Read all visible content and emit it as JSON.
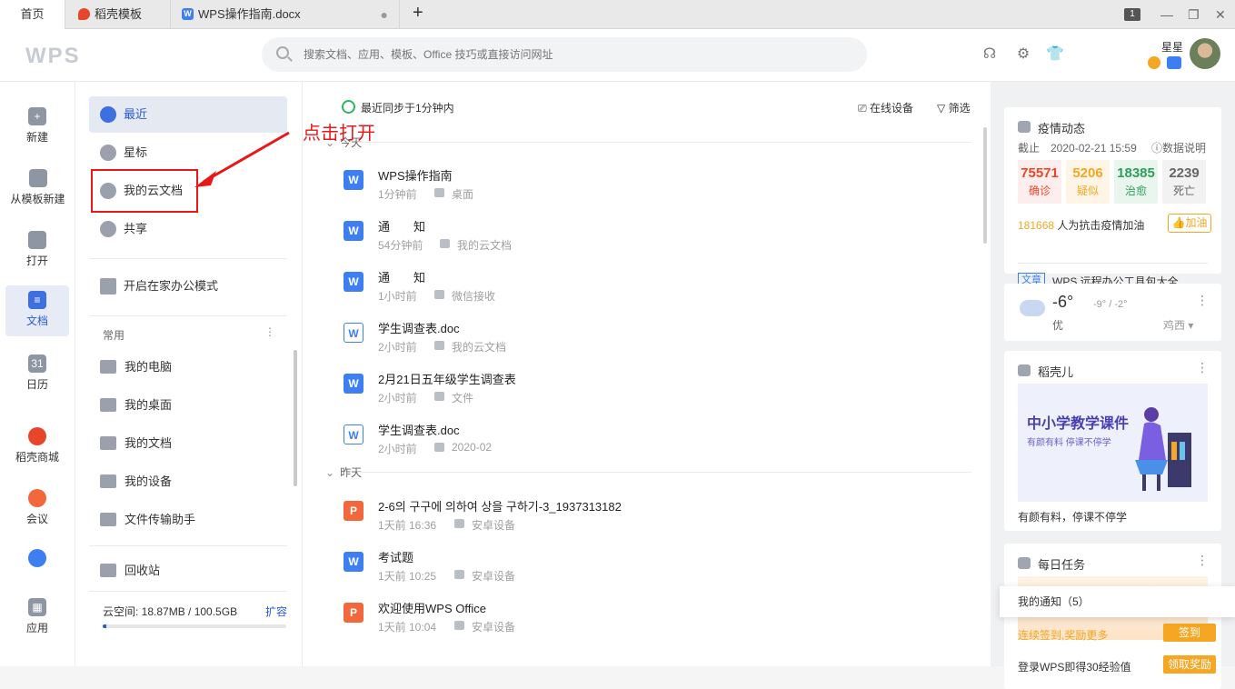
{
  "tabs": {
    "home": "首页",
    "templates": "稻壳模板",
    "document": "WPS操作指南.docx",
    "window_count": "1"
  },
  "search": {
    "placeholder": "搜索文档、应用、模板、Office 技巧或直接访问网址"
  },
  "user": {
    "name": "星星"
  },
  "rail": [
    {
      "label": "新建",
      "icon": "plus-circle-icon"
    },
    {
      "label": "从模板新建",
      "icon": "template-icon"
    },
    {
      "label": "打开",
      "icon": "folder-icon"
    },
    {
      "label": "文档",
      "icon": "document-icon"
    },
    {
      "label": "日历",
      "icon": "calendar-icon"
    },
    {
      "label": "稻壳商城",
      "icon": "docer-store-icon"
    },
    {
      "label": "会议",
      "icon": "meeting-icon"
    },
    {
      "label": "应用",
      "icon": "apps-icon"
    }
  ],
  "nav": {
    "items": [
      {
        "label": "最近",
        "icon": "clock-icon"
      },
      {
        "label": "星标",
        "icon": "star-icon"
      },
      {
        "label": "我的云文档",
        "icon": "cloud-box-icon"
      },
      {
        "label": "共享",
        "icon": "people-icon"
      }
    ],
    "home_mode": "开启在家办公模式",
    "common_label": "常用",
    "common": [
      {
        "label": "我的电脑",
        "icon": "computer-shortcut-icon"
      },
      {
        "label": "我的桌面",
        "icon": "desktop-shortcut-icon"
      },
      {
        "label": "我的文档",
        "icon": "documents-shortcut-icon"
      },
      {
        "label": "我的设备",
        "icon": "devices-icon"
      },
      {
        "label": "文件传输助手",
        "icon": "transfer-icon"
      }
    ],
    "trash": "回收站",
    "cloud_space": "云空间: 18.87MB / 100.5GB",
    "expand": "扩容",
    "usage_fraction": 0.02
  },
  "annotation": "点击打开",
  "main": {
    "sync": "最近同步于1分钟内",
    "online_devices": "在线设备",
    "filter": "筛选",
    "group_today": "今天",
    "group_yesterday": "昨天",
    "files": [
      {
        "name": "WPS操作指南",
        "time": "1分钟前",
        "location": "桌面",
        "type": "w"
      },
      {
        "name": "通　　知",
        "time": "54分钟前",
        "location": "我的云文档",
        "type": "w"
      },
      {
        "name": "通　　知",
        "time": "1小时前",
        "location": "微信接收",
        "type": "w"
      },
      {
        "name": "学生调查表.doc",
        "time": "2小时前",
        "location": "我的云文档",
        "type": "wo"
      },
      {
        "name": "2月21日五年级学生调查表",
        "time": "2小时前",
        "location": "文件",
        "type": "w"
      },
      {
        "name": "学生调查表.doc",
        "time": "2小时前",
        "location": "2020-02",
        "type": "wo"
      },
      {
        "name": "2-6의 구구에 의하여 상을 구하기-3_1937313182",
        "time": "1天前 16:36",
        "location": "安卓设备",
        "type": "p"
      },
      {
        "name": "考试题",
        "time": "1天前 10:25",
        "location": "安卓设备",
        "type": "w"
      },
      {
        "name": "欢迎使用WPS Office",
        "time": "1天前 10:04",
        "location": "安卓设备",
        "type": "p"
      }
    ]
  },
  "covid": {
    "title": "疫情动态",
    "date": "截止　2020-02-21 15:59",
    "help": "数据说明",
    "stats": [
      {
        "value": "75571",
        "label": "确诊",
        "color": "#e8462b"
      },
      {
        "value": "5206",
        "label": "疑似",
        "color": "#f5a623"
      },
      {
        "value": "18385",
        "label": "治愈",
        "color": "#2e9e5b"
      },
      {
        "value": "2239",
        "label": "死亡",
        "color": "#666666"
      }
    ],
    "support_count": "181668",
    "support_text": "人为抗击疫情加油",
    "cheer": "加油",
    "news_tag": "文章",
    "news": "WPS 远程办公工具包大全"
  },
  "weather": {
    "temp": "-6°",
    "range": "-9° / -2°",
    "aq": "优",
    "city": "鸡西 ▾"
  },
  "docer": {
    "title": "稻壳儿",
    "banner_title": "中小学教学课件",
    "banner_sub": "有颜有料  停课不停学",
    "caption": "有颜有料，停课不停学"
  },
  "tasks": {
    "title": "每日任务",
    "line1": "连续签到,奖励更多",
    "sign": "签到",
    "line2": "登录WPS即得30经验值",
    "reward": "领取奖励"
  },
  "notification": "我的通知（5）"
}
